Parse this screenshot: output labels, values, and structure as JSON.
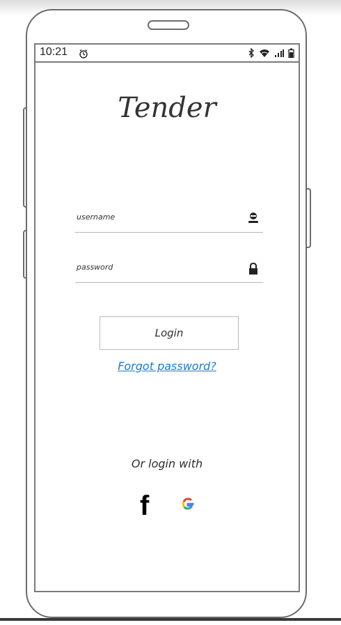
{
  "status_bar": {
    "time": "10:21",
    "icons": [
      "alarm-icon",
      "bluetooth-icon",
      "wifi-icon",
      "signal-icon",
      "battery-icon"
    ]
  },
  "app": {
    "title": "Tender"
  },
  "form": {
    "username_label": "username",
    "password_label": "password",
    "username_icon": "user-icon",
    "password_icon": "lock-icon",
    "login_label": "Login",
    "forgot_label": "Forgot password?"
  },
  "social": {
    "heading": "Or login with",
    "facebook_glyph": "f",
    "providers": [
      "facebook-icon",
      "google-icon"
    ]
  },
  "colors": {
    "link": "#1a7ad6",
    "frame": "#6b6b6b",
    "text": "#2d2d2d"
  }
}
